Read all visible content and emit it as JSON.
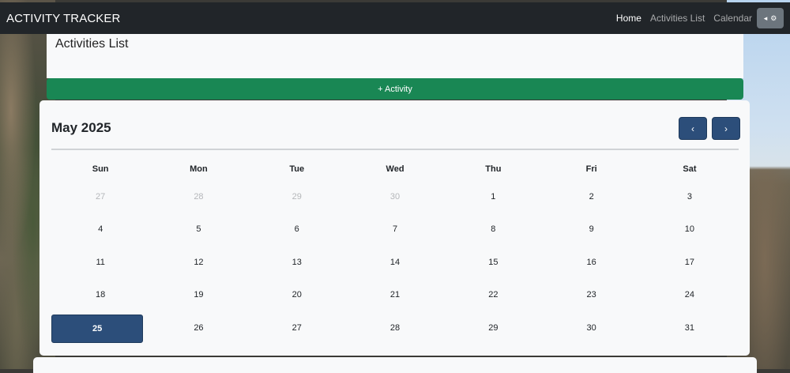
{
  "navbar": {
    "brand": "ACTIVITY TRACKER",
    "links": [
      "Home",
      "Activities List",
      "Calendar"
    ],
    "toggle_icons": [
      "◂",
      "⚙"
    ]
  },
  "page": {
    "title": "Activities List",
    "add_button": "+ Activity"
  },
  "calendar": {
    "month_label": "May 2025",
    "prev": "‹",
    "next": "›",
    "weekdays": [
      "Sun",
      "Mon",
      "Tue",
      "Wed",
      "Thu",
      "Fri",
      "Sat"
    ],
    "weeks": [
      [
        "27",
        "28",
        "29",
        "30",
        "1",
        "2",
        "3"
      ],
      [
        "4",
        "5",
        "6",
        "7",
        "8",
        "9",
        "10"
      ],
      [
        "11",
        "12",
        "13",
        "14",
        "15",
        "16",
        "17"
      ],
      [
        "18",
        "19",
        "20",
        "21",
        "22",
        "23",
        "24"
      ],
      [
        "25",
        "26",
        "27",
        "28",
        "29",
        "30",
        "31"
      ]
    ],
    "today": "25",
    "colors": {
      "accent": "#2c4e7a",
      "add": "#198754",
      "navbar": "#212529"
    }
  }
}
